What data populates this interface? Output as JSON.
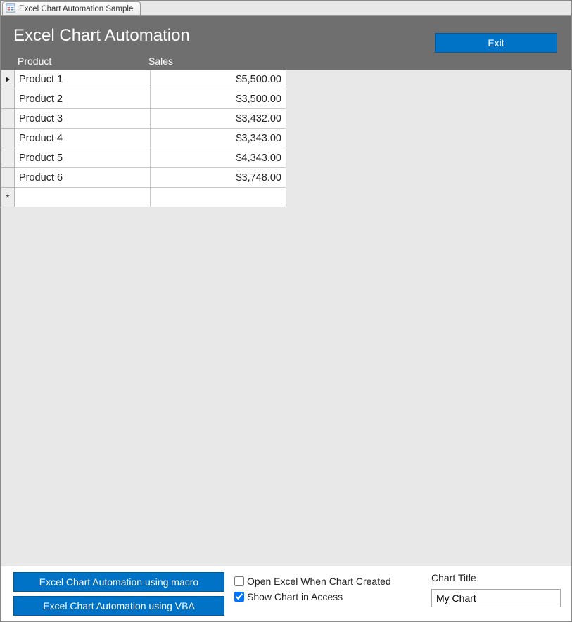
{
  "tab": {
    "label": "Excel Chart Automation Sample"
  },
  "banner": {
    "title": "Excel Chart Automation",
    "exit_label": "Exit"
  },
  "columns": {
    "product": "Product",
    "sales": "Sales"
  },
  "rows": [
    {
      "product": "Product 1",
      "sales": "$5,500.00"
    },
    {
      "product": "Product 2",
      "sales": "$3,500.00"
    },
    {
      "product": "Product 3",
      "sales": "$3,432.00"
    },
    {
      "product": "Product 4",
      "sales": "$3,343.00"
    },
    {
      "product": "Product 5",
      "sales": "$4,343.00"
    },
    {
      "product": "Product 6",
      "sales": "$3,748.00"
    }
  ],
  "bottom": {
    "macro_btn": "Excel Chart Automation using macro",
    "vba_btn": "Excel Chart Automation using VBA",
    "open_excel_label": "Open Excel When Chart Created",
    "open_excel_checked": false,
    "show_chart_label": "Show Chart in Access",
    "show_chart_checked": true,
    "chart_title_label": "Chart Title",
    "chart_title_value": "My Chart"
  },
  "chart_data": {
    "type": "bar",
    "title": "My Chart",
    "categories": [
      "Product 1",
      "Product 2",
      "Product 3",
      "Product 4",
      "Product 5",
      "Product 6"
    ],
    "values": [
      5500.0,
      3500.0,
      3432.0,
      3343.0,
      4343.0,
      3748.0
    ],
    "xlabel": "Product",
    "ylabel": "Sales",
    "ylim": [
      0,
      6000
    ]
  }
}
